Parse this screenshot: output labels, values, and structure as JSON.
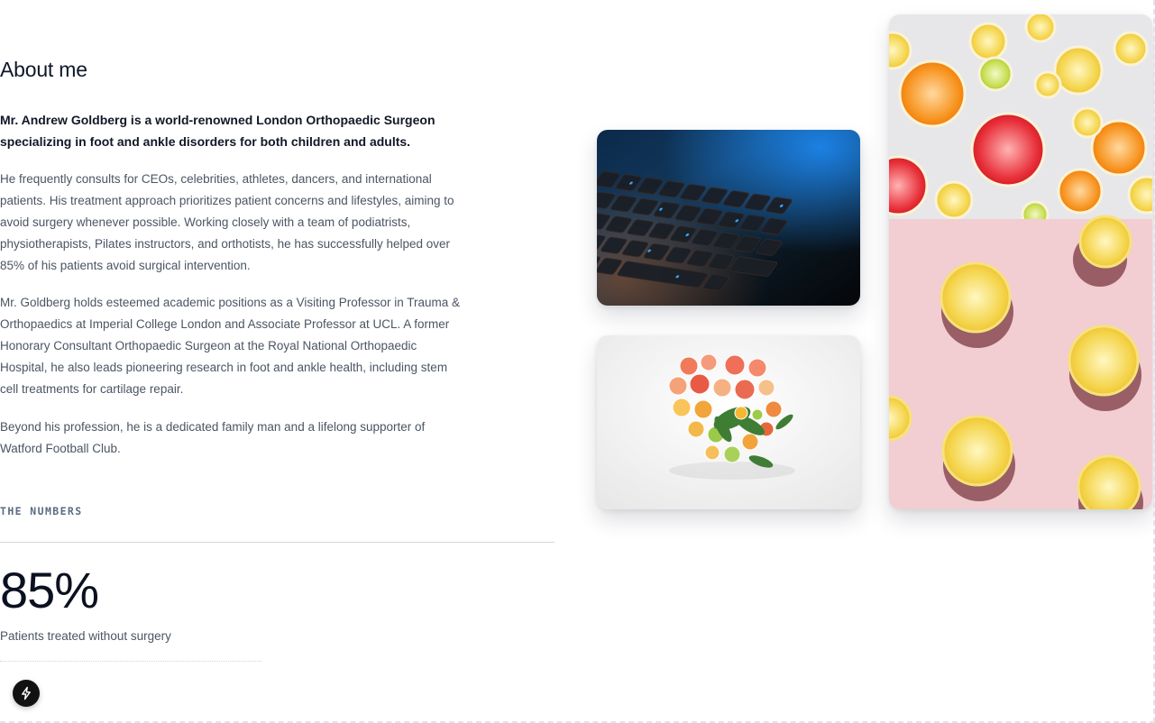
{
  "about": {
    "heading": "About me",
    "lead": "Mr. Andrew Goldberg is a world-renowned London Orthopaedic Surgeon specializing in foot and ankle disorders for both children and adults.",
    "paragraphs": [
      "He frequently consults for CEOs, celebrities, athletes, dancers, and international patients. His treatment approach prioritizes patient concerns and lifestyles, aiming to avoid surgery whenever possible. Working closely with a team of podiatrists, physiotherapists, Pilates instructors, and orthotists, he has successfully helped over 85% of his patients avoid surgical intervention.",
      "Mr. Goldberg holds esteemed academic positions as a Visiting Professor in Trauma & Orthopaedics at Imperial College London and Associate Professor at UCL. A former Honorary Consultant Orthopaedic Surgeon at the Royal National Orthopaedic Hospital, he also leads pioneering research in foot and ankle health, including stem cell treatments for cartilage repair.",
      "Beyond his profession, he is a dedicated family man and a lifelong supporter of Watford Football Club."
    ]
  },
  "numbers": {
    "label": "THE NUMBERS",
    "stats": [
      {
        "value": "85%",
        "label": "Patients treated without surgery"
      }
    ]
  },
  "images": [
    {
      "subject": "backlit-keyboard"
    },
    {
      "subject": "citrus-heart-arrangement"
    },
    {
      "subject": "citrus-slices-collage"
    }
  ],
  "badge": {
    "icon": "lightning-bolt-icon"
  },
  "colors": {
    "heading": "#0f172a",
    "body_text": "#4b5563",
    "label_text": "#5b6b83",
    "divider": "#d4d8de"
  }
}
